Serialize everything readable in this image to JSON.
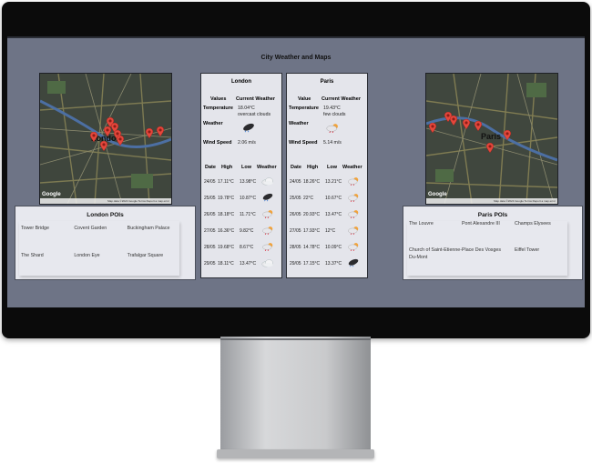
{
  "page": {
    "title": "City Weather and Maps"
  },
  "maps": {
    "london": {
      "label": "London",
      "google": "Google",
      "footer": "Map data ©2024 Google  Terms  Report a map error",
      "marker_count": 9
    },
    "paris": {
      "label": "Paris",
      "google": "Google",
      "footer": "Map data ©2024 Google  Terms  Report a map error",
      "marker_count": 7
    }
  },
  "london_pois": {
    "title": "London POIs",
    "items": [
      "Tower Bridge",
      "Covent Garden",
      "Buckingham Palace",
      "The Shard",
      "London Eye",
      "Trafalgar Square"
    ]
  },
  "paris_pois": {
    "title": "Paris POIs",
    "items": [
      "The Louvre",
      "Pont Alexandre III",
      "Champs Elysees",
      "Church of Saint-Etienne-Du-Mont",
      "Place Des Vosges",
      "Eiffel Tower"
    ]
  },
  "london_weather": {
    "city": "London",
    "col_values": "Values",
    "col_current": "Current Weather",
    "temperature_label": "Temperature",
    "temperature_value": "18.04°C",
    "temperature_desc": "overcast clouds",
    "weather_label": "Weather",
    "wind_label": "Wind Speed",
    "wind_value": "2.06 m/s",
    "forecast_headers": [
      "Date",
      "High",
      "Low",
      "Weather"
    ],
    "forecast": [
      {
        "date": "24/05",
        "high": "17.11°C",
        "low": "13.98°C",
        "icon": "cloud-icon"
      },
      {
        "date": "25/05",
        "high": "19.78°C",
        "low": "10.87°C",
        "icon": "rain-cloud-icon"
      },
      {
        "date": "26/05",
        "high": "18.18°C",
        "low": "11.71°C",
        "icon": "sun-rain-cloud-icon"
      },
      {
        "date": "27/05",
        "high": "16.36°C",
        "low": "9.82°C",
        "icon": "sun-rain-cloud-icon"
      },
      {
        "date": "28/05",
        "high": "19.68°C",
        "low": "8.67°C",
        "icon": "sun-rain-cloud-icon"
      },
      {
        "date": "29/05",
        "high": "18.11°C",
        "low": "13.47°C",
        "icon": "cloud-icon"
      }
    ]
  },
  "paris_weather": {
    "city": "Paris",
    "col_values": "Value",
    "col_current": "Current Weather",
    "temperature_label": "Temperature",
    "temperature_value": "19.43°C",
    "temperature_desc": "few clouds",
    "weather_label": "Weather",
    "wind_label": "Wind Speed",
    "wind_value": "5.14 m/s",
    "forecast_headers": [
      "Date",
      "High",
      "Low",
      "Weather"
    ],
    "forecast": [
      {
        "date": "24/05",
        "high": "18.26°C",
        "low": "13.21°C",
        "icon": "sun-rain-cloud-icon"
      },
      {
        "date": "25/05",
        "high": "22°C",
        "low": "10.67°C",
        "icon": "sun-rain-cloud-icon"
      },
      {
        "date": "26/05",
        "high": "20.93°C",
        "low": "13.47°C",
        "icon": "sun-rain-cloud-icon"
      },
      {
        "date": "27/05",
        "high": "17.93°C",
        "low": "12°C",
        "icon": "sun-rain-cloud-icon"
      },
      {
        "date": "28/05",
        "high": "14.78°C",
        "low": "10.09°C",
        "icon": "sun-rain-cloud-icon"
      },
      {
        "date": "29/05",
        "high": "17.15°C",
        "low": "13.37°C",
        "icon": "rain-cloud-icon"
      }
    ]
  },
  "colors": {
    "screen_bg": "#6e7486",
    "panel_bg": "#e4e5eb",
    "marker": "#e4473c"
  }
}
